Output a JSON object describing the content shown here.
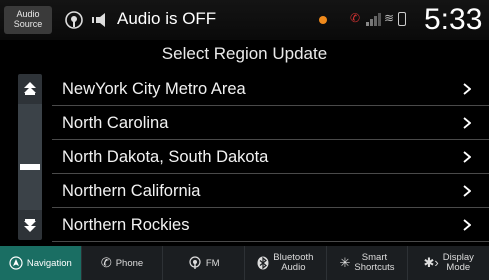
{
  "status": {
    "audio_source_line1": "Audio",
    "audio_source_line2": "Source",
    "audio_status": "Audio is OFF",
    "time": "5:33"
  },
  "title": "Select Region Update",
  "regions": [
    "NewYork City Metro Area",
    "North Carolina",
    "North Dakota, South Dakota",
    "Northern California",
    "Northern Rockies"
  ],
  "bottom_bar": {
    "navigation": "Navigation",
    "phone": "Phone",
    "fm": "FM",
    "bluetooth_line1": "Bluetooth",
    "bluetooth_line2": "Audio",
    "smart_line1": "Smart",
    "smart_line2": "Shortcuts",
    "display_line1": "Display",
    "display_line2": "Mode"
  },
  "colors": {
    "active_tab": "#1a6e63",
    "scrollbar": "#2e3338",
    "accent_orange": "#f08a1c"
  }
}
